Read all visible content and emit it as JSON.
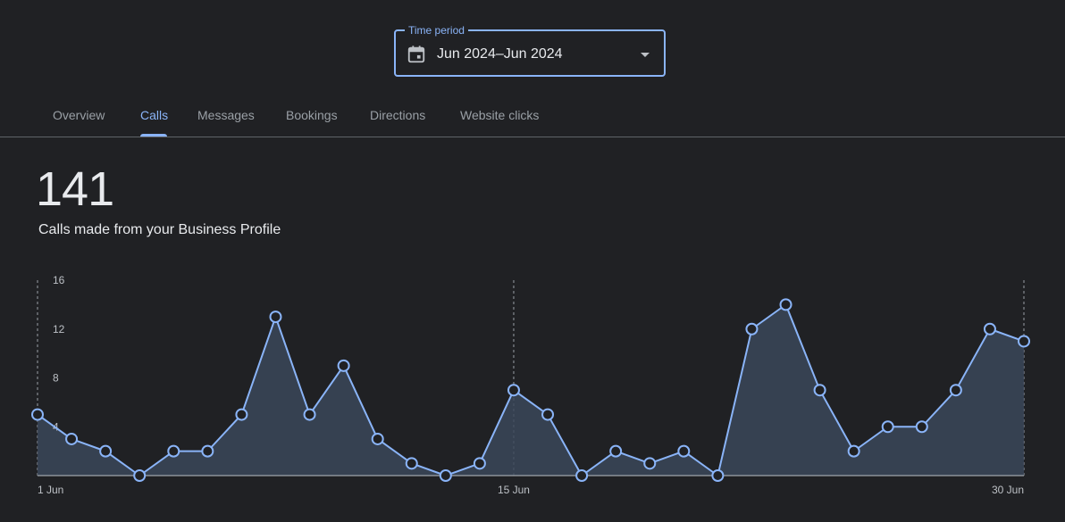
{
  "time_period": {
    "legend": "Time period",
    "value": "Jun 2024–Jun 2024"
  },
  "tabs": [
    {
      "label": "Overview",
      "active": false
    },
    {
      "label": "Calls",
      "active": true
    },
    {
      "label": "Messages",
      "active": false
    },
    {
      "label": "Bookings",
      "active": false
    },
    {
      "label": "Directions",
      "active": false
    },
    {
      "label": "Website clicks",
      "active": false
    }
  ],
  "metric": {
    "value": "141",
    "caption": "Calls made from your Business Profile"
  },
  "colors": {
    "accent": "#8ab4f8",
    "background": "#202124",
    "area_fill": "#3b4659"
  },
  "chart_data": {
    "type": "area",
    "x": [
      1,
      2,
      3,
      4,
      5,
      6,
      7,
      8,
      9,
      10,
      11,
      12,
      13,
      14,
      15,
      16,
      17,
      18,
      19,
      20,
      21,
      22,
      23,
      24,
      25,
      26,
      27,
      28,
      29,
      30
    ],
    "series": [
      {
        "values": [
          5,
          3,
          2,
          0,
          2,
          2,
          5,
          13,
          5,
          9,
          3,
          1,
          0,
          1,
          7,
          5,
          0,
          2,
          1,
          2,
          0,
          12,
          14,
          7,
          2,
          4,
          4,
          7,
          12,
          11
        ]
      }
    ],
    "ylim": [
      0,
      16
    ],
    "yticks": [
      "4",
      "8",
      "12",
      "16"
    ],
    "xticks": [
      {
        "day": 1,
        "label": "1 Jun"
      },
      {
        "day": 15,
        "label": "15 Jun"
      },
      {
        "day": 30,
        "label": "30 Jun"
      }
    ],
    "grid": "vertical dashed lines at labelled dates"
  }
}
